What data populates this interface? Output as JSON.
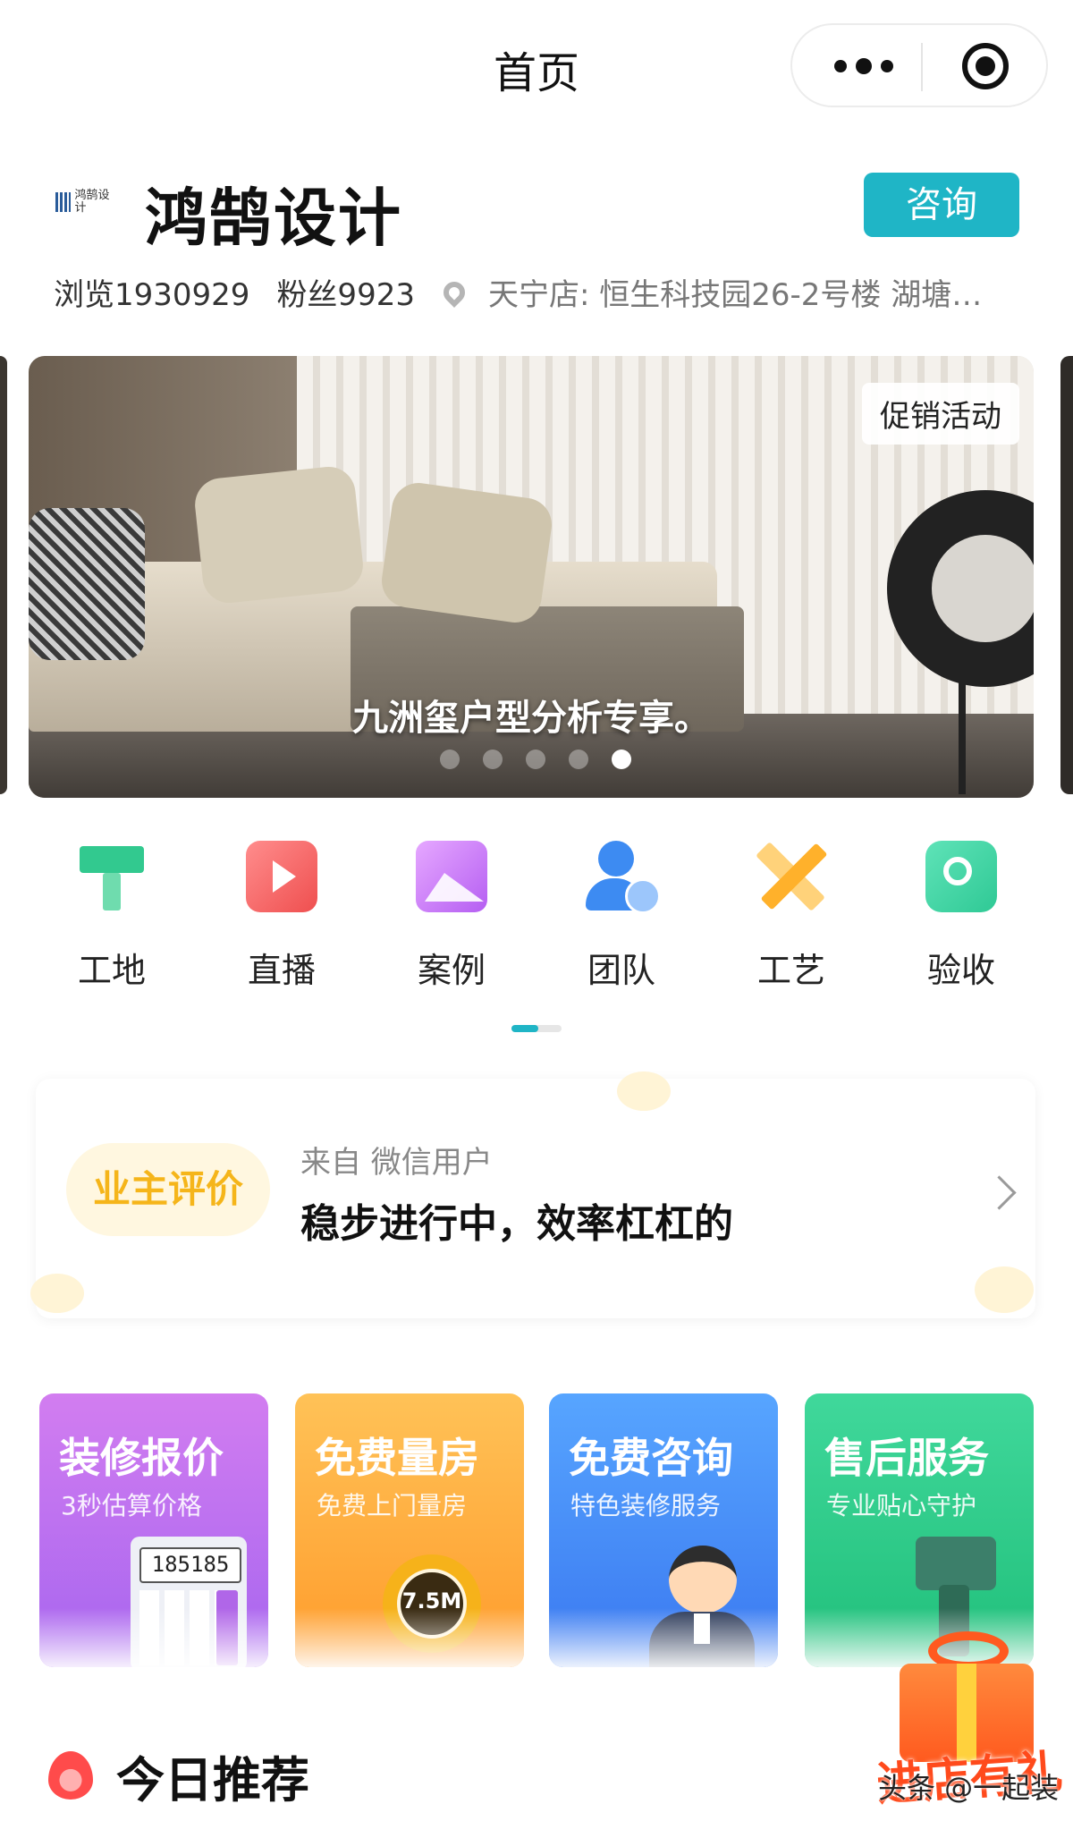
{
  "topbar": {
    "title": "首页",
    "more_icon": "more-dots-icon",
    "close_icon": "target-record-icon"
  },
  "shop": {
    "logo_text": "鸿鹄设计",
    "name": "鸿鹄设计",
    "consult_label": "咨询",
    "views": "浏览1930929",
    "fans": "粉丝9923",
    "location": "天宁店: 恒生科技园26-2号楼 湖塘…",
    "accent_color": "#1fb5c6"
  },
  "banner": {
    "tag": "促销活动",
    "caption": "九洲玺户型分析专享。",
    "slide_count": 5,
    "active_slide": 5
  },
  "nav": {
    "items": [
      {
        "label": "工地",
        "icon": "paint-brush-icon"
      },
      {
        "label": "直播",
        "icon": "play-icon"
      },
      {
        "label": "案例",
        "icon": "image-icon"
      },
      {
        "label": "团队",
        "icon": "team-icon"
      },
      {
        "label": "工艺",
        "icon": "pencil-ruler-icon"
      },
      {
        "label": "验收",
        "icon": "search-check-icon"
      }
    ],
    "page_count": 2,
    "active_page": 1
  },
  "review": {
    "badge": "业主评价",
    "from": "来自 微信用户",
    "text": "稳步进行中，效率杠杠的"
  },
  "services": [
    {
      "title": "装修报价",
      "subtitle": "3秒估算价格",
      "display": "185185",
      "color": "#b46ff0"
    },
    {
      "title": "免费量房",
      "subtitle": "免费上门量房",
      "tape": "7.5M",
      "color": "#ffa93a"
    },
    {
      "title": "免费咨询",
      "subtitle": "特色装修服务",
      "color": "#4a8ff8"
    },
    {
      "title": "售后服务",
      "subtitle": "专业贴心守护",
      "color": "#2ecb88"
    }
  ],
  "gift": {
    "text": "进店有礼"
  },
  "recommend": {
    "title": "今日推荐"
  },
  "watermark": "头条 @一起装"
}
